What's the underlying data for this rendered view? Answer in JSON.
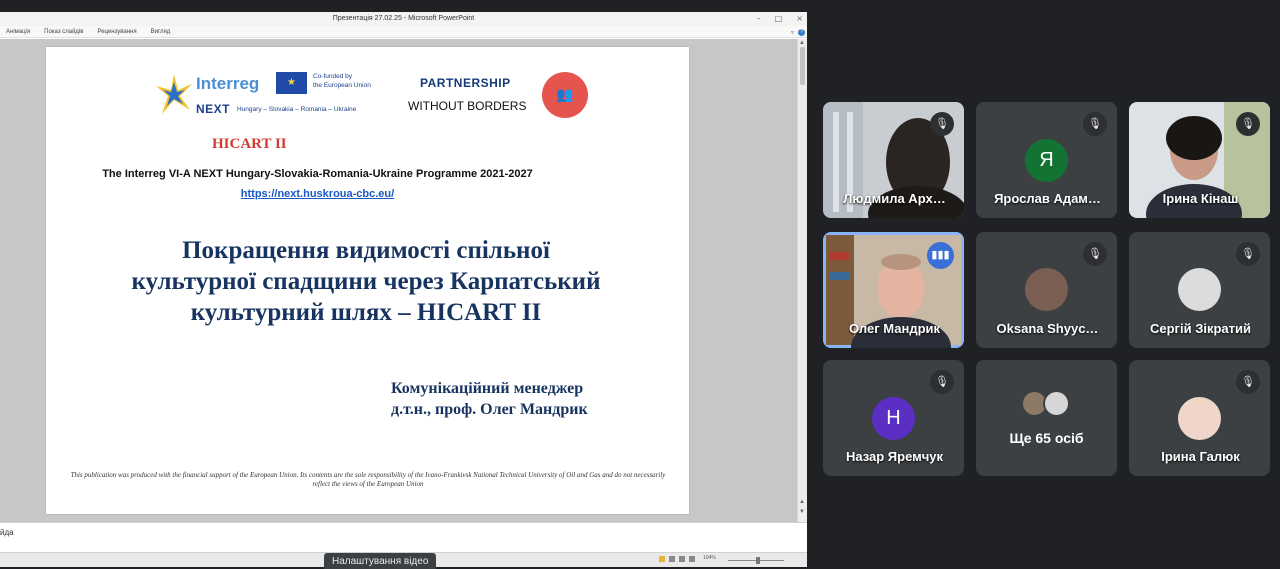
{
  "window": {
    "title": "Презентація 27.02.25  -  Microsoft PowerPoint",
    "controls": [
      "–",
      "□",
      "×"
    ]
  },
  "ribbon": {
    "tabs": [
      "Анімація",
      "Показ слайдів",
      "Рецензування",
      "Вигляд"
    ]
  },
  "notes": {
    "text": "йда"
  },
  "status": {
    "zoom": "104%"
  },
  "tooltip": "Налаштування відео",
  "slide": {
    "logo_interreg": "Interreg",
    "logo_cofunded": "Co-funded by\nthe European Union",
    "logo_next": "NEXT",
    "logo_countries": "Hungary – Slovakia – Romania – Ukraine",
    "partnership_line1": "PARTNERSHIP",
    "partnership_line2": "WITHOUT BORDERS",
    "project": "HICART II",
    "programme": "The Interreg VI-A NEXT Hungary-Slovakia-Romania-Ukraine Programme 2021-2027",
    "link": "https://next.huskroua-cbc.eu/",
    "title_line1": "Покращення видимості спільної",
    "title_line2": "культурної спадщини через Карпатський",
    "title_line3": "культурний шлях – HICART II",
    "manager_line1": "Комунікаційний  менеджер",
    "manager_line2": "д.т.н., проф. Олег Мандрик",
    "disclaimer": "This publication was produced with the financial support of the European Union. Its contents are the sole responsibility of the Ivano-Frankivsk National Technical University of Oil and Gas and do not necessarily reflect the views of the European Union"
  },
  "participants": [
    {
      "name": "Людмила Арх…",
      "muted": true,
      "avatar": "",
      "color": ""
    },
    {
      "name": "Ярослав Адам…",
      "muted": true,
      "avatar": "Я",
      "color": "#137333"
    },
    {
      "name": "Ірина Кінаш",
      "muted": true,
      "avatar": "",
      "color": ""
    },
    {
      "name": "Олег Мандрик",
      "muted": false,
      "speaking": true,
      "avatar": "",
      "color": ""
    },
    {
      "name": "Oksana Shyyc…",
      "muted": true,
      "avatar": "",
      "color": ""
    },
    {
      "name": "Сергій Зікратий",
      "muted": true,
      "avatar": "",
      "color": ""
    },
    {
      "name": "Назар Яремчук",
      "muted": true,
      "avatar": "Н",
      "color": "#5b2fc4"
    },
    {
      "name": "Ще 65 осіб",
      "muted": false,
      "avatar": "",
      "color": ""
    },
    {
      "name": "Ірина Галюк",
      "muted": true,
      "avatar": "",
      "color": ""
    }
  ],
  "colors": {
    "meet_bg": "#202124",
    "tile_bg": "#3c4043",
    "active_border": "#8ab4f8",
    "title_blue": "#17335f",
    "project_red": "#d23b32"
  }
}
